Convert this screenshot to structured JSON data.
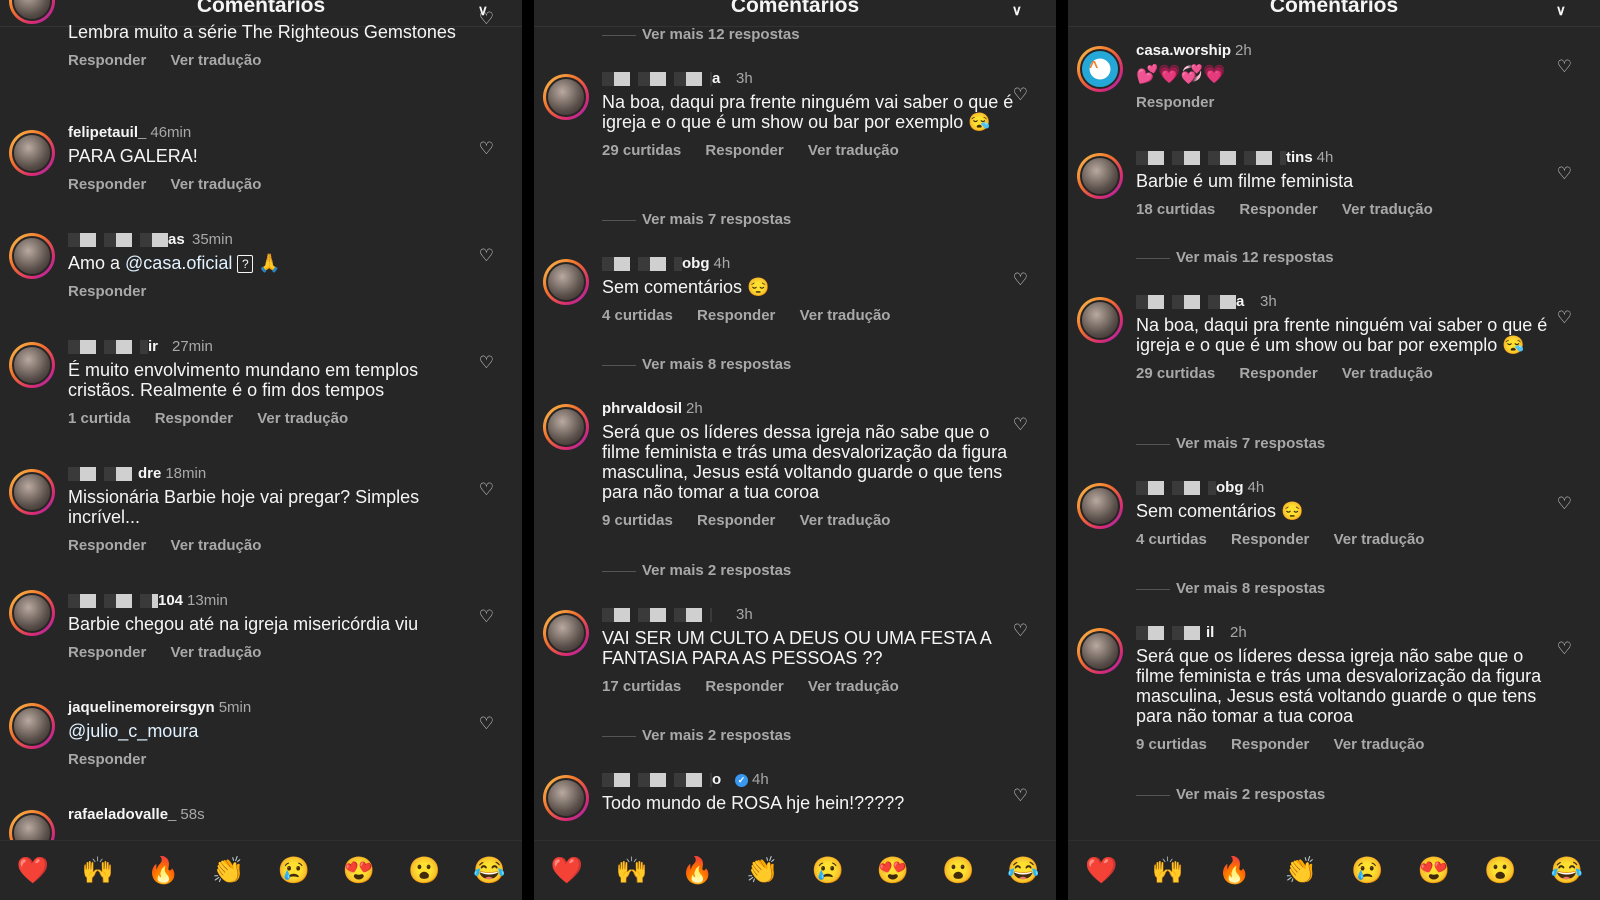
{
  "header": {
    "title": "Comentários"
  },
  "emoji_bar": [
    "❤️",
    "🙌",
    "🔥",
    "👏",
    "😢",
    "😍",
    "😮",
    "😂"
  ],
  "panels": [
    {
      "comments": [
        {
          "user": "",
          "time": "",
          "text": "Lembra muito a série The Righteous Gemstones",
          "likes": "",
          "reply": "Responder",
          "translate": "Ver tradução"
        },
        {
          "user": "felipetauil_",
          "time": "46min",
          "text": "PARA GALERA!",
          "likes": "",
          "reply": "Responder",
          "translate": "Ver tradução"
        },
        {
          "user": "as",
          "time": "35min",
          "text_before": "Amo a ",
          "mention": "@casa.oficial",
          "text_after": " 🙏",
          "qbox": "?",
          "likes": "",
          "reply": "Responder",
          "translate": ""
        },
        {
          "user": "ir",
          "time": "27min",
          "text": "É muito envolvimento mundano em templos cristãos.  Realmente é o fim dos tempos",
          "likes": "1 curtida",
          "reply": "Responder",
          "translate": "Ver tradução"
        },
        {
          "user": "dre",
          "time": "18min",
          "text": "Missionária Barbie hoje vai pregar? Simples incrível...",
          "likes": "",
          "reply": "Responder",
          "translate": "Ver tradução"
        },
        {
          "user": "104",
          "time": "13min",
          "text": "Barbie chegou até na igreja misericórdia viu",
          "likes": "",
          "reply": "Responder",
          "translate": "Ver tradução"
        },
        {
          "user": "jaquelinemoreirsgyn",
          "time": "5min",
          "mention": "@julio_c_moura",
          "likes": "",
          "reply": "Responder",
          "translate": ""
        },
        {
          "user": "rafaeladovalle_",
          "time": "58s"
        }
      ]
    },
    {
      "more_top": "Ver mais 12 respostas",
      "comments": [
        {
          "user": "a",
          "time": "3h",
          "text": "Na boa, daqui pra frente ninguém vai saber o que é igreja e o que é um show ou bar por exemplo 😪",
          "likes": "29 curtidas",
          "reply": "Responder",
          "translate": "Ver tradução",
          "more": "Ver mais 7 respostas"
        },
        {
          "user": "obg",
          "time": "4h",
          "text": "Sem comentários 😔",
          "likes": "4 curtidas",
          "reply": "Responder",
          "translate": "Ver tradução",
          "more": "Ver mais 8 respostas"
        },
        {
          "user": "phrvaldosil",
          "time": "2h",
          "text": "Será que os líderes dessa igreja não sabe que o filme feminista e trás uma desvalorização da figura masculina, Jesus está voltando guarde o que tens para não tomar a tua coroa",
          "likes": "9 curtidas",
          "reply": "Responder",
          "translate": "Ver tradução",
          "more": "Ver mais 2 respostas"
        },
        {
          "user": "",
          "time": "3h",
          "text": "VAI SER UM CULTO A DEUS OU UMA FESTA A FANTASIA PARA AS PESSOAS ??",
          "likes": "17 curtidas",
          "reply": "Responder",
          "translate": "Ver tradução",
          "more": "Ver mais 2 respostas"
        },
        {
          "user": "o",
          "time": "4h",
          "text": "Todo mundo de ROSA hje hein!?????"
        }
      ]
    },
    {
      "comments": [
        {
          "user": "casa.worship",
          "time": "2h",
          "text": "💕💗💞💗",
          "likes": "",
          "reply": "Responder",
          "translate": ""
        },
        {
          "user": "tins",
          "time": "4h",
          "text": "Barbie é um filme feminista",
          "likes": "18 curtidas",
          "reply": "Responder",
          "translate": "Ver tradução",
          "more": "Ver mais 12 respostas"
        },
        {
          "user": "a",
          "time": "3h",
          "text": "Na boa, daqui pra frente ninguém vai saber o que é igreja e o que é um show ou bar por exemplo 😪",
          "likes": "29 curtidas",
          "reply": "Responder",
          "translate": "Ver tradução",
          "more": "Ver mais 7 respostas"
        },
        {
          "user": "obg",
          "time": "4h",
          "text": "Sem comentários 😔",
          "likes": "4 curtidas",
          "reply": "Responder",
          "translate": "Ver tradução",
          "more": "Ver mais 8 respostas"
        },
        {
          "user": "il",
          "time": "2h",
          "text": "Será que os líderes dessa igreja não sabe que o filme feminista e trás uma desvalorização da figura masculina, Jesus está voltando guarde o que tens para não tomar a tua coroa",
          "likes": "9 curtidas",
          "reply": "Responder",
          "translate": "Ver tradução",
          "more": "Ver mais 2 respostas"
        }
      ]
    }
  ]
}
